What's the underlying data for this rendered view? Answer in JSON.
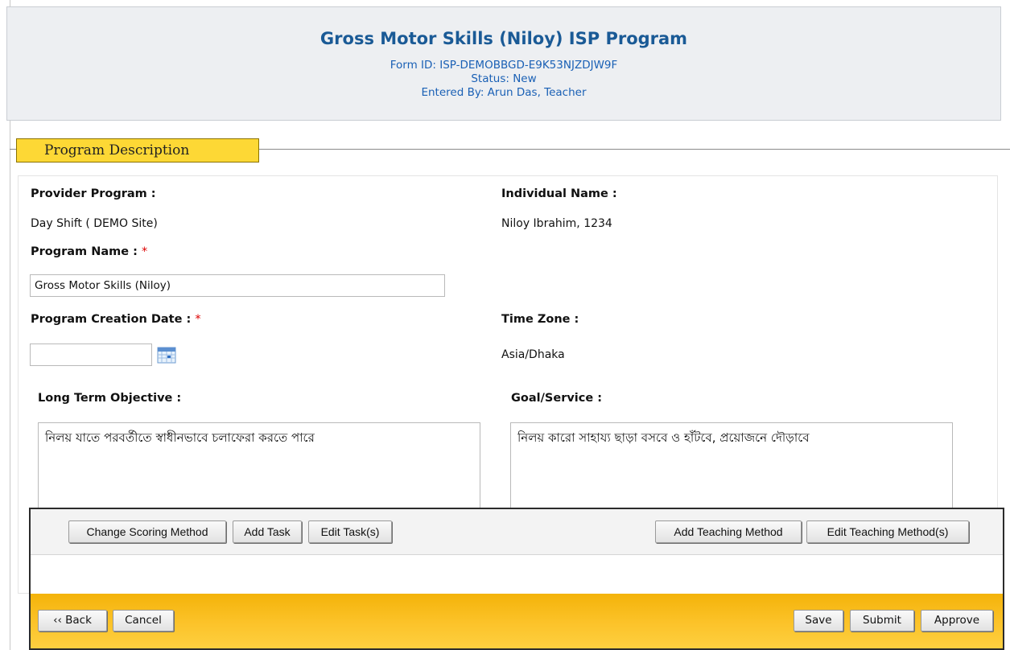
{
  "header": {
    "title": "Gross Motor Skills (Niloy) ISP Program",
    "form_id": "Form ID: ISP-DEMOBBGD-E9K53NJZDJW9F",
    "status": "Status: New",
    "entered_by": "Entered By: Arun Das, Teacher"
  },
  "section": {
    "legend": "Program Description"
  },
  "form": {
    "provider_program_label": "Provider Program :",
    "provider_program_value": "Day Shift ( DEMO Site)",
    "individual_name_label": "Individual Name :",
    "individual_name_value": "Niloy Ibrahim, 1234",
    "program_name_label": "Program Name :",
    "required_mark": "*",
    "program_name_value": "Gross Motor Skills (Niloy)",
    "creation_date_label": "Program Creation Date :",
    "creation_date_value": "",
    "time_zone_label": "Time Zone :",
    "time_zone_value": "Asia/Dhaka",
    "long_term_objective_label": "Long Term Objective :",
    "long_term_objective_value": "নিলয় যাতে পরবর্তীতে স্বাধীনভাবে চলাফেরা করতে পারে",
    "goal_service_label": "Goal/Service :",
    "goal_service_value": "নিলয় কারো সাহায্য ছাড়া বসবে ও হাঁটবে, প্রয়োজনে দৌড়াবে"
  },
  "toolbar": {
    "change_scoring_method": "Change Scoring Method",
    "add_task": "Add Task",
    "edit_tasks": "Edit Task(s)",
    "add_teaching_method": "Add Teaching Method",
    "edit_teaching_methods": "Edit Teaching Method(s)"
  },
  "bottom_bar": {
    "back": "‹‹ Back",
    "cancel": "Cancel",
    "save": "Save",
    "submit": "Submit",
    "approve": "Approve"
  },
  "colors": {
    "title_blue": "#1a5a96",
    "legend_yellow": "#fdd835",
    "bottom_bar_orange": "#fcc32a",
    "required_red": "#dd0000"
  },
  "icons": {
    "date_picker": "calendar-icon"
  }
}
